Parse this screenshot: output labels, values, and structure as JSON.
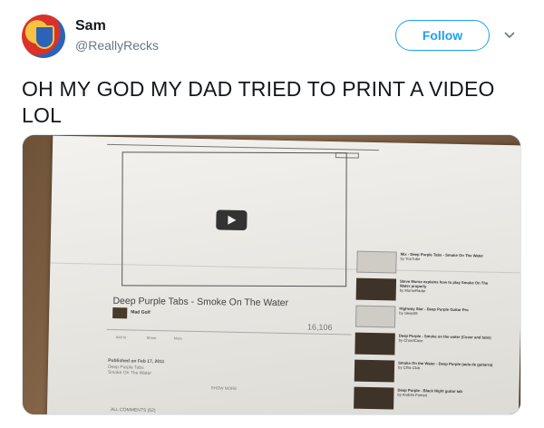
{
  "tweet": {
    "display_name": "Sam",
    "handle": "@ReallyRecks",
    "follow_label": "Follow",
    "text": "OH MY GOD MY DAD TRIED TO PRINT A VIDEO LOL"
  },
  "media": {
    "printed_video": {
      "title": "Deep Purple Tabs - Smoke On The Water",
      "channel": "Mad Golf",
      "views": "16,106",
      "upload": "Upload",
      "actions": [
        "Add to",
        "Share",
        "More"
      ],
      "published": "Published on Feb 17, 2011",
      "description": "Deep Purple Tabs\nSmoke On The Water",
      "show_more": "SHOW MORE",
      "comments": "ALL COMMENTS (52)",
      "sidebar": [
        {
          "title": "Mix - Deep Purple Tabs - Smoke On The Water",
          "meta": "by YouTube"
        },
        {
          "title": "Steve Morse explains how to play Smoke On The Water properly",
          "meta": "by MorseRadar"
        },
        {
          "title": "Highway Star - Deep Purple Guitar Pro",
          "meta": "by sleep09"
        },
        {
          "title": "Deep Purple - Smoke on the water (Cover and tabs)",
          "meta": "by ChordCave"
        },
        {
          "title": "Smoke On the Water - Deep Purple (aula de guitarra)",
          "meta": "by Cifra Club"
        },
        {
          "title": "Deep Purple - Black Night guitar tab",
          "meta": "by Andrés Fumeó"
        }
      ]
    }
  }
}
